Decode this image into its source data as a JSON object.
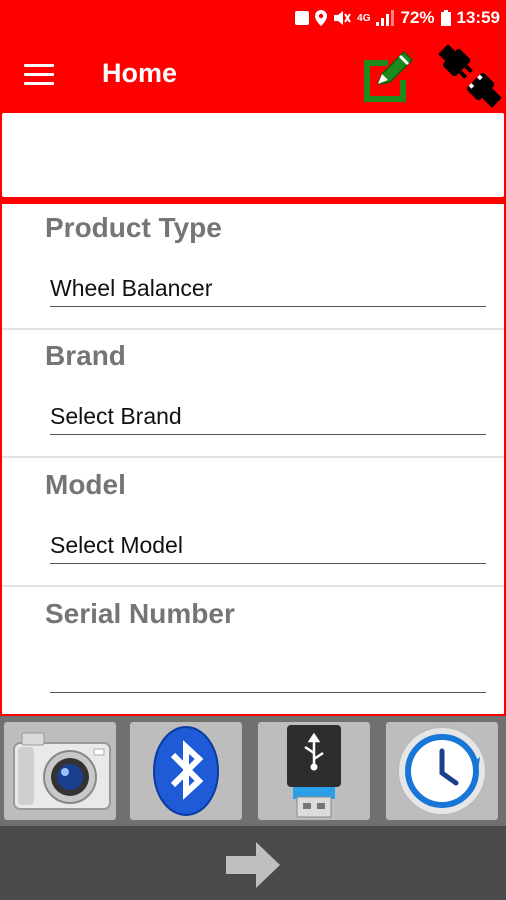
{
  "status_bar": {
    "battery": "72%",
    "time": "13:59",
    "signal": "4G"
  },
  "app_bar": {
    "title": "Home",
    "menu_icon": "hamburger-menu-icon",
    "edit_icon": "edit-note-icon",
    "disconnect_icon": "unplugged-cable-icon"
  },
  "form": {
    "fields": [
      {
        "label": "Product Type",
        "value": "Wheel Balancer"
      },
      {
        "label": "Brand",
        "value": "Select Brand"
      },
      {
        "label": "Model",
        "value": "Select Model"
      },
      {
        "label": "Serial Number",
        "value": ""
      }
    ]
  },
  "toolbar": {
    "items": [
      {
        "name": "camera",
        "icon": "camera-icon"
      },
      {
        "name": "bluetooth",
        "icon": "bluetooth-icon"
      },
      {
        "name": "usb",
        "icon": "usb-drive-icon"
      },
      {
        "name": "history",
        "icon": "history-clock-icon"
      }
    ]
  },
  "next": {
    "icon": "arrow-right-icon"
  },
  "colors": {
    "primary": "#ff0000",
    "edit_green": "#1e8a1e",
    "label_gray": "#757575"
  }
}
